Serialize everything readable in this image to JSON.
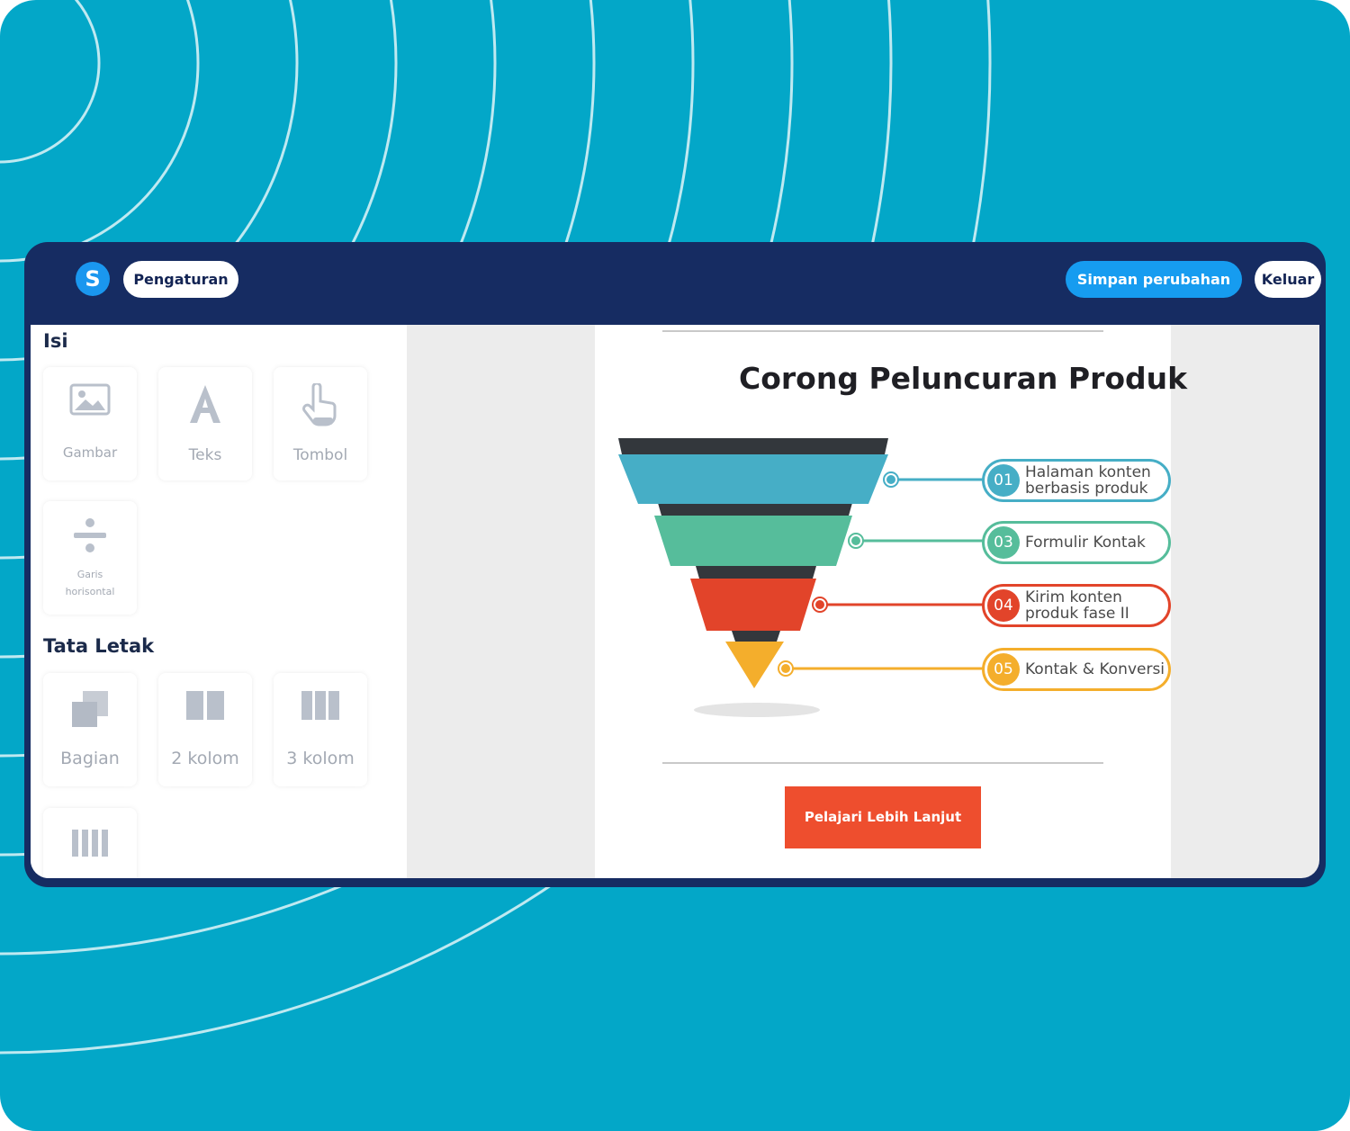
{
  "header": {
    "logo_letter": "S",
    "settings_label": "Pengaturan",
    "save_label": "Simpan perubahan",
    "exit_label": "Keluar"
  },
  "sidebar": {
    "content_heading": "Isi",
    "content_items": [
      {
        "label": "Gambar",
        "icon": "image-icon"
      },
      {
        "label": "Teks",
        "icon": "text-icon"
      },
      {
        "label": "Tombol",
        "icon": "pointer-hand-icon"
      },
      {
        "label": "Garis horisontal",
        "icon": "divide-icon"
      }
    ],
    "layout_heading": "Tata Letak",
    "layout_items": [
      {
        "label": "Bagian",
        "icon": "section-icon"
      },
      {
        "label": "2 kolom",
        "icon": "two-columns-icon"
      },
      {
        "label": "3 kolom",
        "icon": "three-columns-icon"
      },
      {
        "label": "",
        "icon": "four-columns-icon"
      }
    ]
  },
  "canvas": {
    "title": "Corong Peluncuran Produk",
    "stages": [
      {
        "number": "01",
        "label": "Halaman konten berbasis produk",
        "color": "#46aec6"
      },
      {
        "number": "03",
        "label": "Formulir Kontak",
        "color": "#56bd9b"
      },
      {
        "number": "04",
        "label": "Kirim konten produk fase II",
        "color": "#e2442a"
      },
      {
        "number": "05",
        "label": "Kontak & Konversi",
        "color": "#f4ae2c"
      }
    ],
    "cta_label": "Pelajari Lebih Lanjut"
  },
  "colors": {
    "background": "#03a7c8",
    "window": "#162c62",
    "primary_button": "#169cf0",
    "cta": "#ee4e2e"
  }
}
